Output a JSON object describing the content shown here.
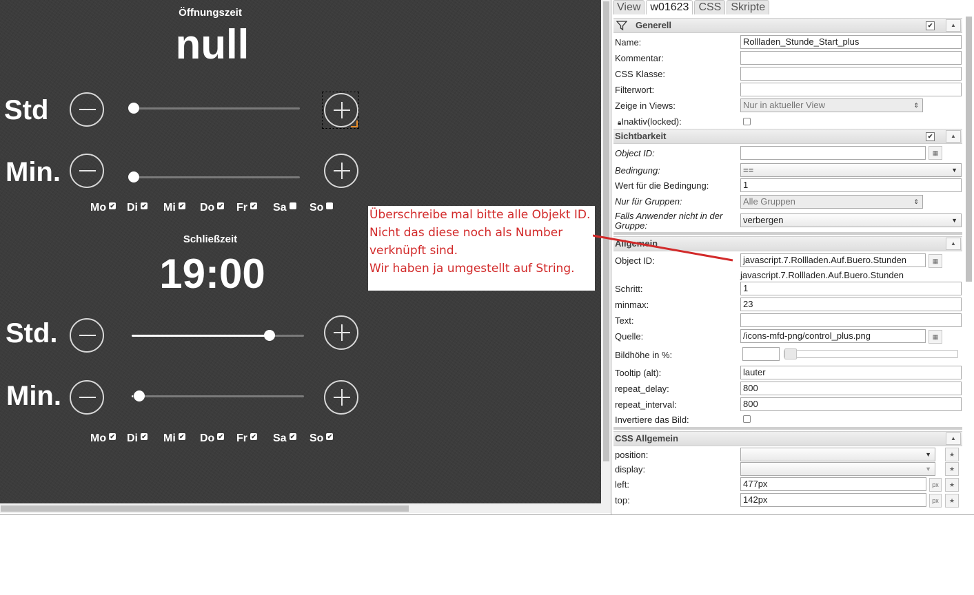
{
  "canvas": {
    "open_block": {
      "title": "Öffnungszeit",
      "value": "null"
    },
    "close_block": {
      "title": "Schließzeit",
      "value": "19:00"
    },
    "rows": [
      {
        "label": "Std",
        "slider": 0.0
      },
      {
        "label": "Min.",
        "slider": 0.0
      },
      {
        "label": "Std.",
        "slider": 0.8
      },
      {
        "label": "Min.",
        "slider": 0.0
      }
    ],
    "days_open": [
      {
        "label": "Mo",
        "checked": true
      },
      {
        "label": "Di",
        "checked": true
      },
      {
        "label": "Mi",
        "checked": true
      },
      {
        "label": "Do",
        "checked": true
      },
      {
        "label": "Fr",
        "checked": true
      },
      {
        "label": "Sa",
        "checked": false
      },
      {
        "label": "So",
        "checked": false
      }
    ],
    "days_close": [
      {
        "label": "Mo",
        "checked": true
      },
      {
        "label": "Di",
        "checked": true
      },
      {
        "label": "Mi",
        "checked": true
      },
      {
        "label": "Do",
        "checked": true
      },
      {
        "label": "Fr",
        "checked": true
      },
      {
        "label": "Sa",
        "checked": true
      },
      {
        "label": "So",
        "checked": true
      }
    ],
    "annotation": {
      "line1": "Überschreibe mal bitte alle Objekt ID.",
      "line2": "Nicht das diese noch als Number",
      "line3": "verknüpft sind.",
      "line4": "Wir haben ja umgestellt auf String.",
      "color": "#d22a2a"
    }
  },
  "panel": {
    "tabs": [
      "View",
      "w01623",
      "CSS",
      "Skripte"
    ],
    "generell": {
      "title": "Generell",
      "name_label": "Name:",
      "name_value": "Rollladen_Stunde_Start_plus",
      "kommentar_label": "Kommentar:",
      "css_klasse_label": "CSS Klasse:",
      "filterwort_label": "Filterwort:",
      "zeige_label": "Zeige in Views:",
      "zeige_value": "Nur in aktueller View",
      "inaktiv_label": "Inaktiv(locked):"
    },
    "sichtbarkeit": {
      "title": "Sichtbarkeit",
      "object_id_label": "Object ID:",
      "bedingung_label": "Bedingung:",
      "bedingung_value": "==",
      "wert_label": "Wert für die Bedingung:",
      "wert_value": "1",
      "gruppen_label": "Nur für Gruppen:",
      "gruppen_value": "Alle Gruppen",
      "falls_label": "Falls Anwender nicht in der Gruppe:",
      "falls_value": "verbergen"
    },
    "allgemein": {
      "title": "Allgemein",
      "object_id_label": "Object ID:",
      "object_id_value": "javascript.7.Rollladen.Auf.Buero.Stunden",
      "object_id_hint": "javascript.7.Rollladen.Auf.Buero.Stunden",
      "schritt_label": "Schritt:",
      "schritt_value": "1",
      "minmax_label": "minmax:",
      "minmax_value": "23",
      "text_label": "Text:",
      "quelle_label": "Quelle:",
      "quelle_value": "/icons-mfd-png/control_plus.png",
      "bildhoehe_label": "Bildhöhe in %:",
      "tooltip_label": "Tooltip (alt):",
      "tooltip_value": "lauter",
      "repeat_delay_label": "repeat_delay:",
      "repeat_delay_value": "800",
      "repeat_interval_label": "repeat_interval:",
      "repeat_interval_value": "800",
      "invertiere_label": "Invertiere das Bild:"
    },
    "css_allgemein": {
      "title": "CSS Allgemein",
      "position_label": "position:",
      "display_label": "display:",
      "left_label": "left:",
      "left_value": "477px",
      "top_label": "top:",
      "top_value": "142px",
      "unit": "px"
    }
  }
}
